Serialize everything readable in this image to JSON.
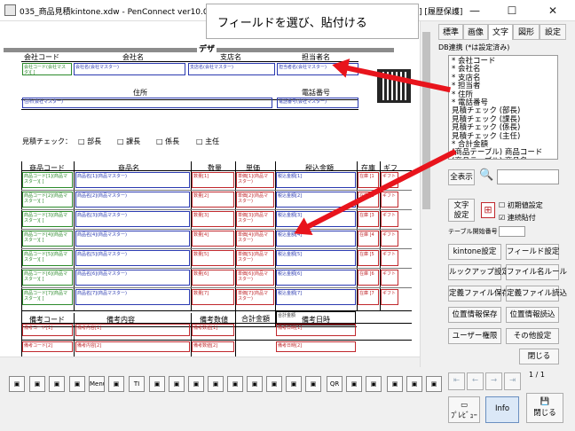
{
  "window": {
    "title": "035_商品見積kintone.xdw - PenConnect ver10.0.121",
    "right_title": "新規] [履歴保護]",
    "minimize": "—",
    "maximize": "☐",
    "close": "✕"
  },
  "tooltip": "フィールドを選び、貼付ける",
  "page": {
    "title_partial": "デザ"
  },
  "form": {
    "header": {
      "company_code": "会社コード",
      "company_name": "会社名",
      "branch": "支店名",
      "person": "担当者名",
      "address": "住所",
      "phone": "電話番号"
    },
    "header_fields": {
      "company_code": "会社コード(会社マスタ)[ ]",
      "company_name": "会社名(会社マスター)",
      "branch": "支店名(会社マスター)",
      "person": "担当者名(会社マスター)",
      "address": "住所(会社マスター)",
      "phone": "電話番号(会社マスター)"
    },
    "check_label": "見積チェック：",
    "checks": [
      "部長",
      "課長",
      "係長",
      "主任"
    ],
    "check_box": "□",
    "table_headers": {
      "code": "商品コード",
      "name": "商品名",
      "qty": "数量",
      "price": "単価",
      "tax": "税込金額",
      "stock": "在庫",
      "gift": "ギフ"
    },
    "rows": [
      {
        "code": "商品コード[1](商品マスター)[ ]",
        "name": "商品名[1](商品マスター)",
        "qty": "数量[1]",
        "price": "単価[1](商品マスター)",
        "tax": "税込金額[1]",
        "stock": "在庫 [1",
        "gift": "ギフト"
      },
      {
        "code": "商品コード[2](商品マスター)[ ]",
        "name": "商品名[2](商品マスター)",
        "qty": "数量[2]",
        "price": "単価[2](商品マスター)",
        "tax": "税込金額[2]",
        "stock": "在庫 [2",
        "gift": "ギフト"
      },
      {
        "code": "商品コード[3](商品マスター)[ ]",
        "name": "商品名[3](商品マスター)",
        "qty": "数量[3]",
        "price": "単価[3](商品マスター)",
        "tax": "税込金額[3]",
        "stock": "在庫 [3",
        "gift": "ギフト"
      },
      {
        "code": "商品コード[4](商品マスター)[ ]",
        "name": "商品名[4](商品マスター)",
        "qty": "数量[4]",
        "price": "単価[4](商品マスター)",
        "tax": "税込金額[4]",
        "stock": "在庫 [4",
        "gift": "ギフト"
      },
      {
        "code": "商品コード[5](商品マスター)[ ]",
        "name": "商品名[5](商品マスター)",
        "qty": "数量[5]",
        "price": "単価[5](商品マスター)",
        "tax": "税込金額[5]",
        "stock": "在庫 [5",
        "gift": "ギフト"
      },
      {
        "code": "商品コード[6](商品マスター)[ ]",
        "name": "商品名[6](商品マスター)",
        "qty": "数量[6]",
        "price": "単価[6](商品マスター)",
        "tax": "税込金額[6]",
        "stock": "在庫 [6",
        "gift": "ギフト"
      },
      {
        "code": "商品コード[7](商品マスター)[ ]",
        "name": "商品名[7](商品マスター)",
        "qty": "数量[7]",
        "price": "単価[7](商品マスター)",
        "tax": "税込金額[7]",
        "stock": "在庫 [7",
        "gift": "ギフト"
      }
    ],
    "total_label": "合計金額",
    "total_field": "合計金額",
    "notes_headers": {
      "code": "備考コード",
      "content": "備考内容",
      "number": "備考数値",
      "datetime": "備考日時"
    },
    "notes_rows": [
      {
        "code": "備考コード[1]",
        "content": "備考内容[1]",
        "number": "備考数値[1]",
        "datetime": "備考日時[1]"
      },
      {
        "code": "備考コード[2]",
        "content": "備考内容[2]",
        "number": "備考数値[2]",
        "datetime": "備考日時[2]"
      }
    ]
  },
  "panel": {
    "tabs": [
      "標準",
      "画像",
      "文字",
      "図形",
      "設定"
    ],
    "db_label": "DB連携 (*は設定済み)",
    "db_items": [
      "* 会社コード",
      "* 会社名",
      "* 支店名",
      "* 担当者",
      "* 住所",
      "* 電話番号",
      "  見積チェック (部長)",
      "  見積チェック (課長)",
      "  見積チェック (係長)",
      "  見積チェック (主任)",
      "* 合計金額",
      "  (商品テーブル) 商品コード",
      "  (商品テーブル) 商品名",
      "* (商品テーブル) 単価"
    ],
    "show_all": "全表示",
    "text_setting": "文字\n設定",
    "init_setting": "初期値設定",
    "continuous_paste": "連続貼付",
    "table_start": "テーブル開始番号",
    "buttons": [
      "kintone設定",
      "フィールド設定",
      "ルックアップ設定",
      "ファイル名ルール",
      "定義ファイル保存",
      "定義ファイル読込",
      "位置情報保存",
      "位置情報読込",
      "ユーザー権限",
      "その他設定"
    ],
    "close_label": "閉じる",
    "page_counter": "1 / 1",
    "preview": "ﾌﾟﾚﾋﾞｭｰ",
    "info": "Info",
    "close_bottom": "閉じる"
  },
  "toolbar": [
    "Menu",
    "TI",
    "QR"
  ],
  "colors": {
    "blue": "#2b3ab0",
    "red": "#c0282d",
    "green": "#2c8a2c",
    "arrow": "#e8141c"
  }
}
